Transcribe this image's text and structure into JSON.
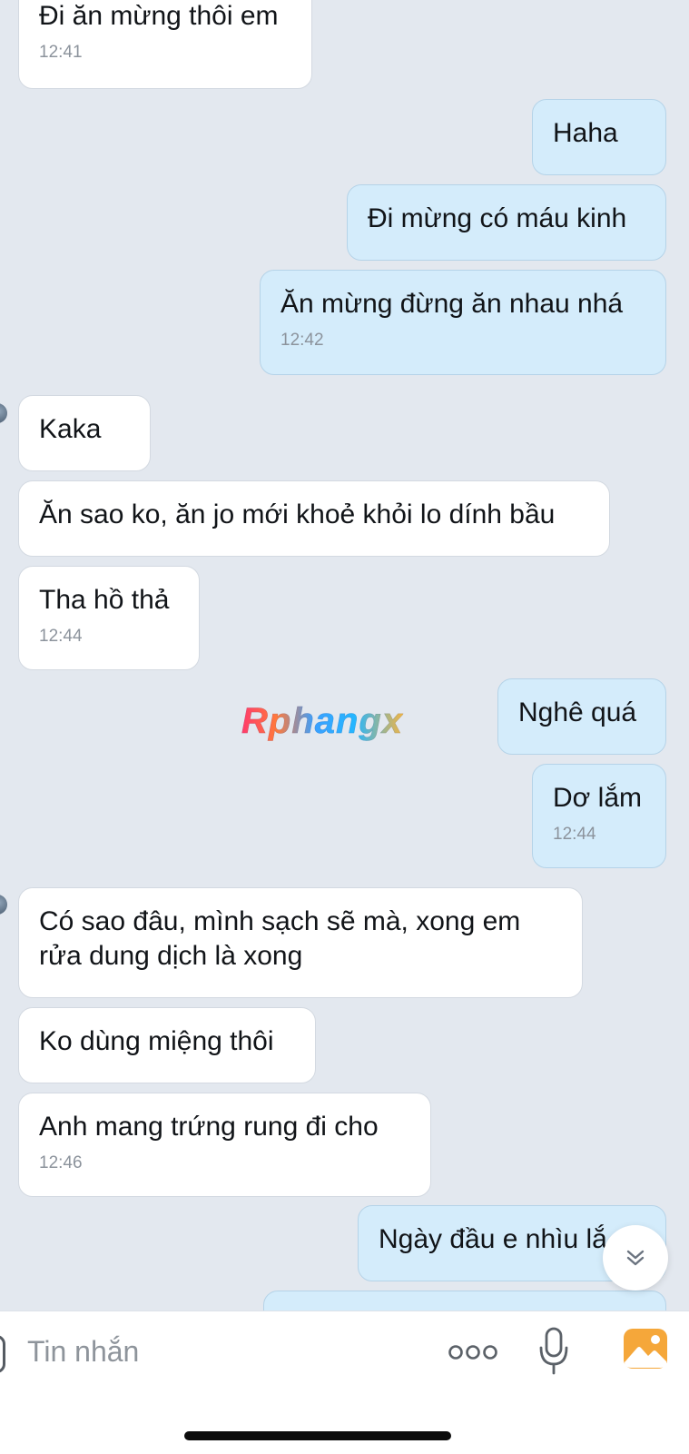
{
  "messages": [
    {
      "side": "in",
      "text": "Đi ăn mừng thôi em",
      "time": "12:41"
    },
    {
      "side": "out",
      "text": "Haha"
    },
    {
      "side": "out",
      "text": "Đi mừng có máu kinh"
    },
    {
      "side": "out",
      "text": "Ăn mừng đừng ăn nhau nhá",
      "time": "12:42"
    },
    {
      "side": "in",
      "text": "Kaka"
    },
    {
      "side": "in",
      "text": "Ăn sao ko, ăn jo mới khoẻ khỏi lo dính bầu"
    },
    {
      "side": "in",
      "text": "Tha hồ thả",
      "time": "12:44"
    },
    {
      "side": "out",
      "text": "Nghê quá"
    },
    {
      "side": "out",
      "text": "Dơ lắm",
      "time": "12:44"
    },
    {
      "side": "in",
      "text": "Có sao đâu, mình sạch sẽ mà, xong em rửa dung dịch là xong"
    },
    {
      "side": "in",
      "text": "Ko dùng miệng thôi"
    },
    {
      "side": "in",
      "text": "Anh mang trứng rung đi cho",
      "time": "12:46"
    },
    {
      "side": "out",
      "text": "Ngày đầu e nhìu lắ"
    }
  ],
  "watermark": "Rphangx",
  "composer": {
    "placeholder": "Tin nhắn",
    "icons": [
      "more-icon",
      "microphone-icon",
      "image-icon"
    ]
  },
  "scroll_button_icon": "double-chevron-down-icon",
  "colors": {
    "background": "#e3e8ef",
    "incoming_bubble": "#ffffff",
    "outgoing_bubble": "#d4ecfb",
    "image_icon": "#f5a73a"
  }
}
